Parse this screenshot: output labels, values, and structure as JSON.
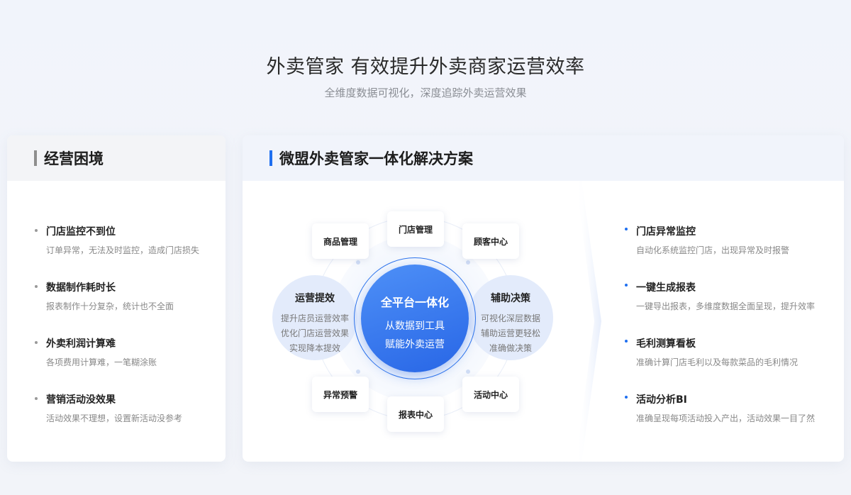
{
  "hero": {
    "title": "外卖管家 有效提升外卖商家运营效率",
    "subtitle": "全维度数据可视化，深度追踪外卖运营效果"
  },
  "pain": {
    "title": "经营困境",
    "items": [
      {
        "title": "门店监控不到位",
        "desc": "订单异常，无法及时监控，造成门店损失"
      },
      {
        "title": "数据制作耗时长",
        "desc": "报表制作十分复杂，统计也不全面"
      },
      {
        "title": "外卖利润计算难",
        "desc": "各项费用计算难，一笔糊涂账"
      },
      {
        "title": "营销活动没效果",
        "desc": "活动效果不理想，设置新活动没参考"
      }
    ]
  },
  "solution": {
    "title": "微盟外卖管家一体化解决方案",
    "core": {
      "title": "全平台一体化",
      "line1": "从数据到工具",
      "line2": "赋能外卖运营"
    },
    "left_bubble": {
      "title": "运营提效",
      "lines": [
        "提升店员运营效率",
        "优化门店运营效果",
        "实现降本提效"
      ]
    },
    "right_bubble": {
      "title": "辅助决策",
      "lines": [
        "可视化深层数据",
        "辅助运营更轻松",
        "准确做决策"
      ]
    },
    "nodes": {
      "store": "门店管理",
      "goods": "商品管理",
      "customer": "顾客中心",
      "alert": "异常预警",
      "activity": "活动中心",
      "report": "报表中心"
    },
    "items": [
      {
        "title": "门店异常监控",
        "desc": "自动化系统监控门店，出现异常及时报警"
      },
      {
        "title": "一键生成报表",
        "desc": "一键导出报表，多维度数据全面呈现，提升效率"
      },
      {
        "title": "毛利测算看板",
        "desc": "准确计算门店毛利以及每款菜品的毛利情况"
      },
      {
        "title": "活动分析BI",
        "desc": "准确呈现每项活动投入产出，活动效果一目了然"
      }
    ]
  },
  "colors": {
    "accent": "#1f6ff0",
    "core_gradient": [
      "#4e90f7",
      "#2866e6"
    ],
    "bubble": "#e3ebfb"
  }
}
